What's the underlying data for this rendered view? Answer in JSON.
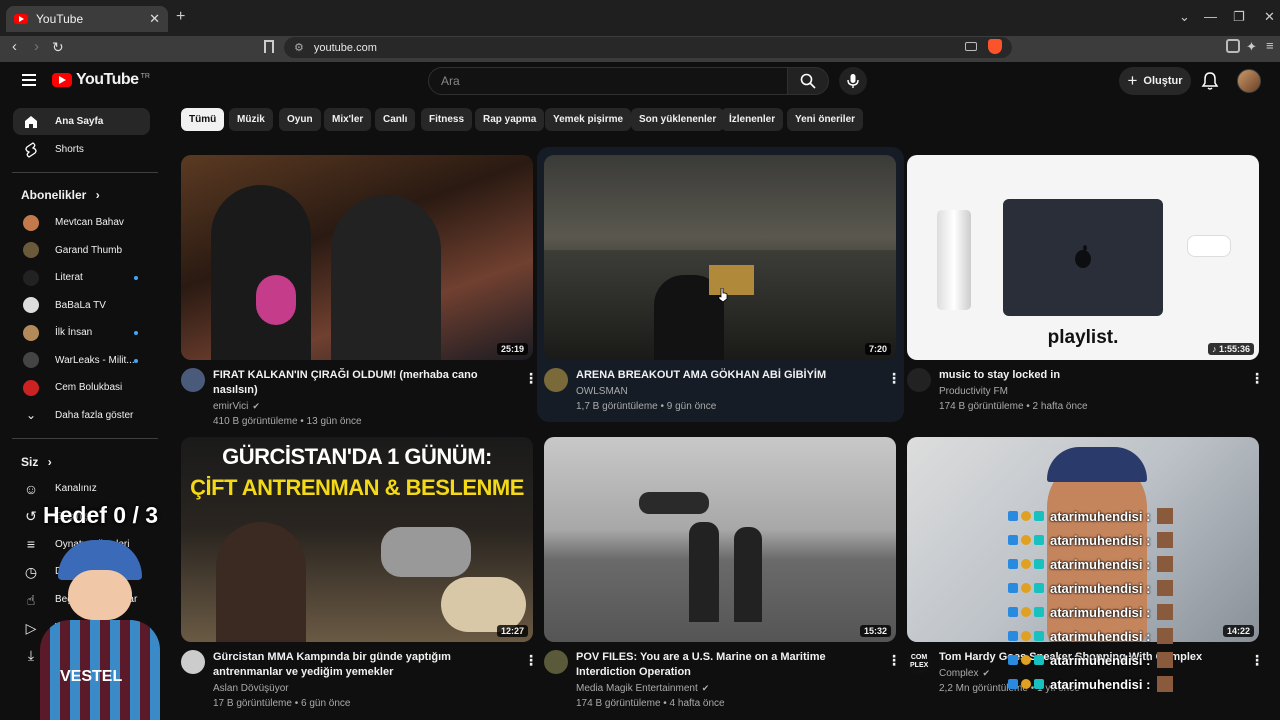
{
  "browser": {
    "tab_title": "YouTube",
    "tab_close": "✕",
    "new_tab": "+",
    "url": "youtube.com",
    "window_controls": [
      "⌄",
      "—",
      "❐",
      "✕"
    ]
  },
  "header": {
    "logo_text": "YouTube",
    "logo_badge": "TR",
    "search_placeholder": "Ara",
    "create_label": "Oluştur",
    "icons": [
      "menu-icon",
      "search-icon",
      "mic-icon",
      "bell-icon",
      "avatar"
    ]
  },
  "sidebar": {
    "main": [
      {
        "label": "Ana Sayfa",
        "icon": "home-icon"
      },
      {
        "label": "Shorts",
        "icon": "shorts-icon"
      }
    ],
    "subs_title": "Abonelikler",
    "subscriptions": [
      {
        "label": "Mevtcan Bahav",
        "color": "#c27a4a",
        "dot": false
      },
      {
        "label": "Garand Thumb",
        "color": "#6b5a3a",
        "dot": false
      },
      {
        "label": "Literat",
        "color": "#222222",
        "dot": true
      },
      {
        "label": "BaBaLa TV",
        "color": "#dddddd",
        "dot": false
      },
      {
        "label": "İlk İnsan",
        "color": "#b58a5a",
        "dot": true
      },
      {
        "label": "WarLeaks - Milit...",
        "color": "#444444",
        "dot": true
      },
      {
        "label": "Cem Bolukbasi",
        "color": "#cc2222",
        "dot": false
      }
    ],
    "show_more": "Daha fazla göster",
    "you_title": "Siz",
    "you_items": [
      {
        "label": "Kanalınız",
        "icon": "channel-icon"
      },
      {
        "label": "Geçmiş",
        "icon": "history-icon"
      },
      {
        "label": "Oynatma listeleri",
        "icon": "playlist-icon"
      },
      {
        "label": "Daha sonra izle",
        "icon": "clock-icon"
      },
      {
        "label": "Beğenilen videolar",
        "icon": "like-icon"
      },
      {
        "label": "Videolarınız",
        "icon": "video-icon"
      },
      {
        "label": "İndirilenler",
        "icon": "download-icon"
      }
    ]
  },
  "chips": [
    "Tümü",
    "Müzik",
    "Oyun",
    "Mix'ler",
    "Canlı",
    "Fitness",
    "Rap yapma",
    "Yemek pişirme",
    "Son yüklenenler",
    "İzlenenler",
    "Yeni öneriler"
  ],
  "videos": [
    {
      "title": "FIRAT KALKAN'IN ÇIRAĞI OLDUM! (merhaba cano nasılsın)",
      "channel": "emirVici",
      "verified": true,
      "meta": "410 B görüntüleme • 13 gün önce",
      "duration": "25:19"
    },
    {
      "title": "ARENA BREAKOUT AMA GÖKHAN ABİ GİBİYİM",
      "channel": "OWLSMAN",
      "verified": false,
      "meta": "1,7 B görüntüleme • 9 gün önce",
      "duration": "7:20"
    },
    {
      "title": "music to stay locked in",
      "channel": "Productivity FM",
      "verified": false,
      "meta": "174 B görüntüleme • 2 hafta önce",
      "duration": "♪ 1:55:36",
      "thumb_text": "playlist."
    },
    {
      "title": "Gürcistan MMA Kampında bir günde yaptığım antrenmanlar ve yediğim yemekler",
      "channel": "Aslan Dövüşüyor",
      "verified": false,
      "meta": "17 B görüntüleme • 6 gün önce",
      "duration": "12:27",
      "thumb_line1": "GÜRCİSTAN'DA 1 GÜNÜM:",
      "thumb_line2": "ÇİFT ANTRENMAN & BESLENME"
    },
    {
      "title": "POV FILES: You are a U.S. Marine on a Maritime Interdiction Operation",
      "channel": "Media Magik Entertainment",
      "verified": true,
      "meta": "174 B görüntüleme • 4 hafta önce",
      "duration": "15:32"
    },
    {
      "title": "Tom Hardy Goes Sneaker Shopping With Complex",
      "channel": "Complex",
      "verified": true,
      "meta": "2,2 Mn görüntüleme • 1 yıl önce",
      "duration": "14:22",
      "channel_badge": "COM PLEX"
    }
  ],
  "overlay": {
    "goal": "Hedef 0 / 3",
    "chat_user": "atarimuhendisi :",
    "chat_count": 8,
    "jersey_text": "VESTEL"
  }
}
